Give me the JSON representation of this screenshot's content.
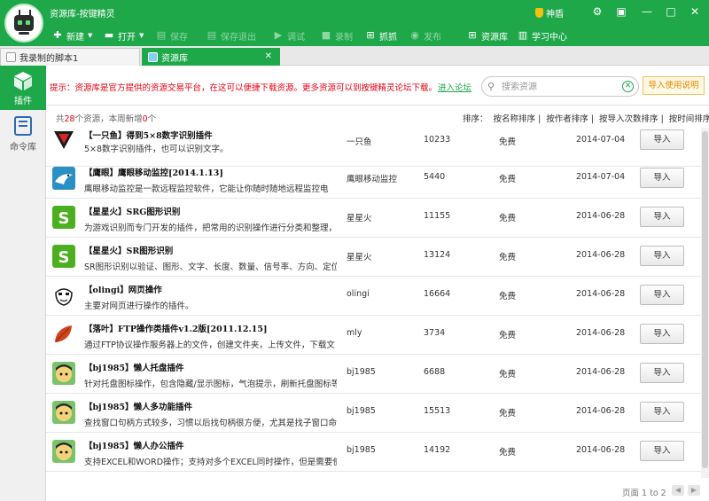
{
  "window": {
    "title": "资源库-按键精灵",
    "shendun_label": "神盾"
  },
  "toolbar": {
    "new_label": "新建",
    "open_label": "打开",
    "save_label": "保存",
    "save_exit_label": "保存退出",
    "debug_label": "调试",
    "record_label": "录制",
    "capture_label": "抓抓",
    "publish_label": "发布",
    "library_label": "资源库",
    "learning_label": "学习中心"
  },
  "tabs": [
    {
      "label": "我录制的脚本1",
      "active": false
    },
    {
      "label": "资源库",
      "active": true
    }
  ],
  "sidebar": {
    "items": [
      {
        "label": "插件",
        "active": true
      },
      {
        "label": "命令库",
        "active": false
      }
    ]
  },
  "notice": {
    "text": "提示：资源库是官方提供的资源交易平台，在这可以便捷下载资源。更多资源可以到按键精灵论坛下载。",
    "forum_link": "进入论坛"
  },
  "search": {
    "placeholder": "搜索资源",
    "value": ""
  },
  "help_button": "导入使用说明",
  "summary": {
    "prefix": "共",
    "total": "28",
    "mid": "个资源，本周新增",
    "new_count": "0",
    "suffix": "个"
  },
  "sort": {
    "label": "排序：",
    "options": [
      "按名称排序",
      "按作者排序",
      "按导入次数排序",
      "按时间排序"
    ],
    "separator": "|"
  },
  "plugins": [
    {
      "name": "【一只鱼】得到5×8数字识别插件",
      "desc": "5×8数字识别插件，也可以识别文字。",
      "author": "一只鱼",
      "count": "10233",
      "price": "免费",
      "date": "2014-07-04",
      "import_label": "导入",
      "icon": "fish-logo-icon"
    },
    {
      "name": "【鹰眼】鹰眼移动监控[2014.1.13]",
      "desc": "鹰眼移动监控是一款远程监控软件，它能让你随时随地远程监控电",
      "author": "鹰眼移动监控",
      "count": "5440",
      "price": "免费",
      "date": "2014-07-04",
      "import_label": "导入",
      "icon": "eagle-icon"
    },
    {
      "name": "【星星火】SRG图形识别",
      "desc": "为游戏识别而专门开发的插件，把常用的识别操作进行分类和整理，",
      "author": "星星火",
      "count": "11155",
      "price": "免费",
      "date": "2014-06-28",
      "import_label": "导入",
      "icon": "s-logo-icon"
    },
    {
      "name": "【星星火】SR图形识别",
      "desc": "SR图形识别以验证、图形、文字、长度、数量、信号率、方向、定位",
      "author": "星星火",
      "count": "13124",
      "price": "免费",
      "date": "2014-06-28",
      "import_label": "导入",
      "icon": "s-logo-icon"
    },
    {
      "name": "【olingi】网页操作",
      "desc": "主要对网页进行操作的插件。",
      "author": "olingi",
      "count": "16664",
      "price": "免费",
      "date": "2014-06-28",
      "import_label": "导入",
      "icon": "face-sketch-icon"
    },
    {
      "name": "【落叶】FTP操作类插件v1.2版[2011.12.15]",
      "desc": "通过FTP协议操作服务器上的文件，创建文件夹，上传文件，下载文",
      "author": "mly",
      "count": "3734",
      "price": "免费",
      "date": "2014-06-28",
      "import_label": "导入",
      "icon": "leaf-icon"
    },
    {
      "name": "【bj1985】懒人托盘插件",
      "desc": "针对托盘图标操作，包含隐藏/显示图标，气泡提示，刷新托盘图标等",
      "author": "bj1985",
      "count": "6688",
      "price": "免费",
      "date": "2014-06-28",
      "import_label": "导入",
      "icon": "cartoon-avatar-icon"
    },
    {
      "name": "【bj1985】懒人多功能插件",
      "desc": "查找窗口句柄方式较多，习惯以后找句柄很方便，尤其是找子窗口命",
      "author": "bj1985",
      "count": "15513",
      "price": "免费",
      "date": "2014-06-28",
      "import_label": "导入",
      "icon": "cartoon-avatar-icon"
    },
    {
      "name": "【bj1985】懒人办公插件",
      "desc": "支持EXCEL和WORD操作；支持对多个EXCEL同时操作，但是需要使",
      "author": "bj1985",
      "count": "14192",
      "price": "免费",
      "date": "2014-06-28",
      "import_label": "导入",
      "icon": "cartoon-avatar-icon"
    }
  ],
  "pager": {
    "label": "页面",
    "range": "1 to 2"
  },
  "colors": {
    "accent": "#1fa84a",
    "notice": "#e60012",
    "help": "#e08a00"
  }
}
